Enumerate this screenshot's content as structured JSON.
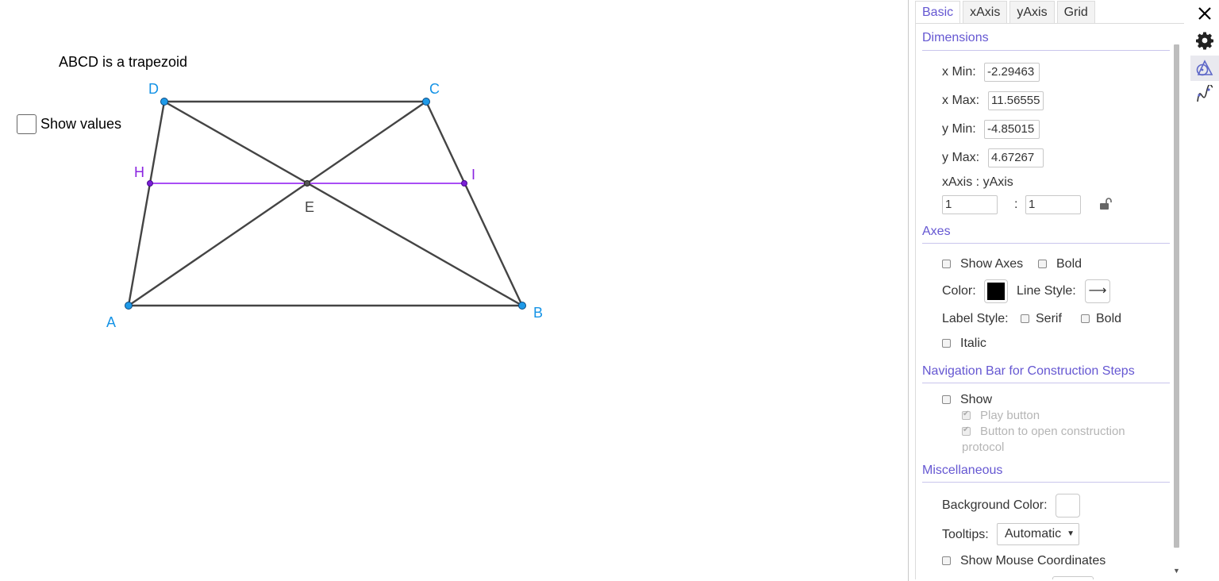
{
  "graphics": {
    "caption": "ABCD is a trapezoid",
    "checkbox_label": "Show values",
    "points": {
      "A": "A",
      "B": "B",
      "C": "C",
      "D": "D",
      "E": "E",
      "H": "H",
      "I": "I"
    },
    "colors": {
      "segment": "#444444",
      "free_point": "#1f9ae8",
      "midline": "#a94ef5",
      "midline_point": "#7a1fd6",
      "label_blue": "#1593e6",
      "label_purple": "#8a24e0"
    }
  },
  "panel": {
    "tabs": [
      "Basic",
      "xAxis",
      "yAxis",
      "Grid"
    ],
    "active_tab": "Basic",
    "dimensions": {
      "title": "Dimensions",
      "xmin_label": "x Min:",
      "xmin": "-2.29463",
      "xmax_label": "x Max:",
      "xmax": "11.56555",
      "ymin_label": "y Min:",
      "ymin": "-4.85015",
      "ymax_label": "y Max:",
      "ymax": "4.67267",
      "ratio_label": "xAxis : yAxis",
      "ratio_x": "1",
      "ratio_sep": ":",
      "ratio_y": "1"
    },
    "axes": {
      "title": "Axes",
      "show_axes": "Show Axes",
      "bold": "Bold",
      "color_label": "Color:",
      "color": "#000000",
      "line_style_label": "Line Style:",
      "line_style_glyph": "⟶",
      "label_style_label": "Label Style:",
      "serif": "Serif",
      "label_bold": "Bold",
      "italic": "Italic"
    },
    "navigation": {
      "title": "Navigation Bar for Construction Steps",
      "show": "Show",
      "play_button": "Play button",
      "open_protocol_1": "Button to open construction",
      "open_protocol_2": "protocol"
    },
    "misc": {
      "title": "Miscellaneous",
      "bg_color_label": "Background Color:",
      "tooltips_label": "Tooltips:",
      "tooltips_value": "Automatic",
      "mouse_coords": "Show Mouse Coordinates"
    }
  },
  "toolbar": {
    "icons": [
      "close-icon",
      "gear-icon",
      "graphics-icon",
      "algebra-curve-icon"
    ]
  }
}
